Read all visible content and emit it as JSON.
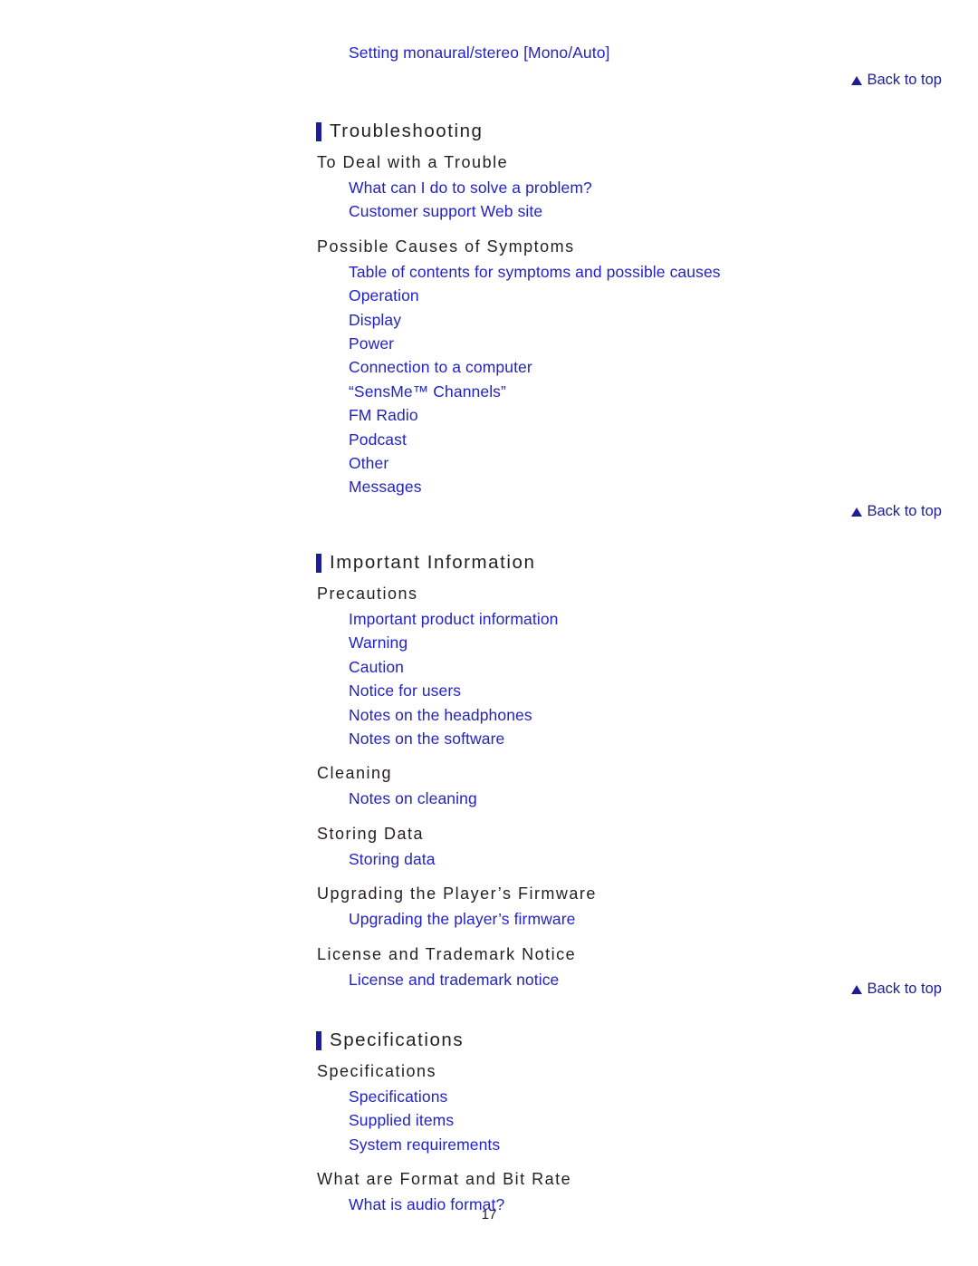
{
  "page": {
    "page_number": "17",
    "link_color": "#2323c4",
    "heading_color": "#231f20",
    "accent_color": "#1c1c9c",
    "background": "#ffffff"
  },
  "top_orphan_link": {
    "label": "Setting monaural/stereo [Mono/Auto]"
  },
  "back_to_top": {
    "label": "Back to top",
    "icon": "triangle-up-icon"
  },
  "sections": [
    {
      "title": "Troubleshooting",
      "groups": [
        {
          "subheading": "To Deal with a Trouble",
          "links": [
            "What can I do to solve a problem?",
            "Customer support Web site"
          ]
        },
        {
          "subheading": "Possible Causes of Symptoms",
          "links": [
            "Table of contents for symptoms and possible causes",
            "Operation",
            "Display",
            "Power",
            "Connection to a computer",
            "“SensMe™ Channels”",
            "FM Radio",
            "Podcast",
            "Other",
            "Messages"
          ]
        }
      ]
    },
    {
      "title": "Important Information",
      "groups": [
        {
          "subheading": "Precautions",
          "links": [
            "Important product information",
            "Warning",
            "Caution",
            "Notice for users",
            "Notes on the headphones",
            "Notes on the software"
          ]
        },
        {
          "subheading": "Cleaning",
          "links": [
            "Notes on cleaning"
          ]
        },
        {
          "subheading": "Storing Data",
          "links": [
            "Storing data"
          ]
        },
        {
          "subheading": "Upgrading the Player’s Firmware",
          "links": [
            "Upgrading the player’s firmware"
          ]
        },
        {
          "subheading": "License and Trademark Notice",
          "links": [
            "License and trademark notice"
          ]
        }
      ]
    },
    {
      "title": "Specifications",
      "groups": [
        {
          "subheading": "Specifications",
          "links": [
            "Specifications",
            "Supplied items",
            "System requirements"
          ]
        },
        {
          "subheading": "What are Format and Bit Rate",
          "links": [
            "What is audio format?"
          ]
        }
      ]
    }
  ]
}
